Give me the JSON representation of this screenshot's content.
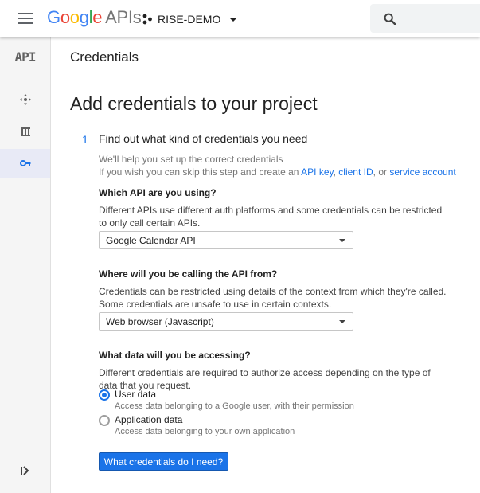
{
  "header": {
    "logo_letters": [
      "G",
      "o",
      "o",
      "g",
      "l",
      "e"
    ],
    "logo_suffix": "APIs",
    "project_name": "RISE-DEMO"
  },
  "leftnav": {
    "api_logo": "API",
    "items": [
      {
        "icon": "dashboard-icon",
        "active": false
      },
      {
        "icon": "library-icon",
        "active": false
      },
      {
        "icon": "key-icon",
        "active": true
      }
    ],
    "expand_icon": "expand-icon"
  },
  "page": {
    "breadcrumb_title": "Credentials",
    "title": "Add credentials to your project"
  },
  "step": {
    "number": "1",
    "title": "Find out what kind of credentials you need",
    "help_line1": "We'll help you set up the correct credentials",
    "help_line2_prefix": "If you wish you can skip this step and create an ",
    "link_api_key": "API key",
    "sep1": ", ",
    "link_client_id": "client ID",
    "sep2": ", or ",
    "link_service_account": "service account"
  },
  "q1": {
    "label": "Which API are you using?",
    "desc_line1": "Different APIs use different auth platforms and some credentials can be restricted",
    "desc_line2": "to only call certain APIs.",
    "selected": "Google Calendar API"
  },
  "q2": {
    "label": "Where will you be calling the API from?",
    "desc_line1": "Credentials can be restricted using details of the context from which they're called.",
    "desc_line2": "Some credentials are unsafe to use in certain contexts.",
    "selected": "Web browser (Javascript)"
  },
  "q3": {
    "label": "What data will you be accessing?",
    "desc_line1": "Different credentials are required to authorize access depending on the type of",
    "desc_line2": "data that you request.",
    "options": [
      {
        "label": "User data",
        "sub": "Access data belonging to a Google user, with their permission",
        "checked": true
      },
      {
        "label": "Application data",
        "sub": "Access data belonging to your own application",
        "checked": false
      }
    ]
  },
  "cta_label": "What credentials do I need?",
  "colors": {
    "accent": "#1a73e8",
    "google_blue": "#4285F4",
    "google_red": "#EA4335",
    "google_yellow": "#FBBC05",
    "google_green": "#34A853"
  }
}
